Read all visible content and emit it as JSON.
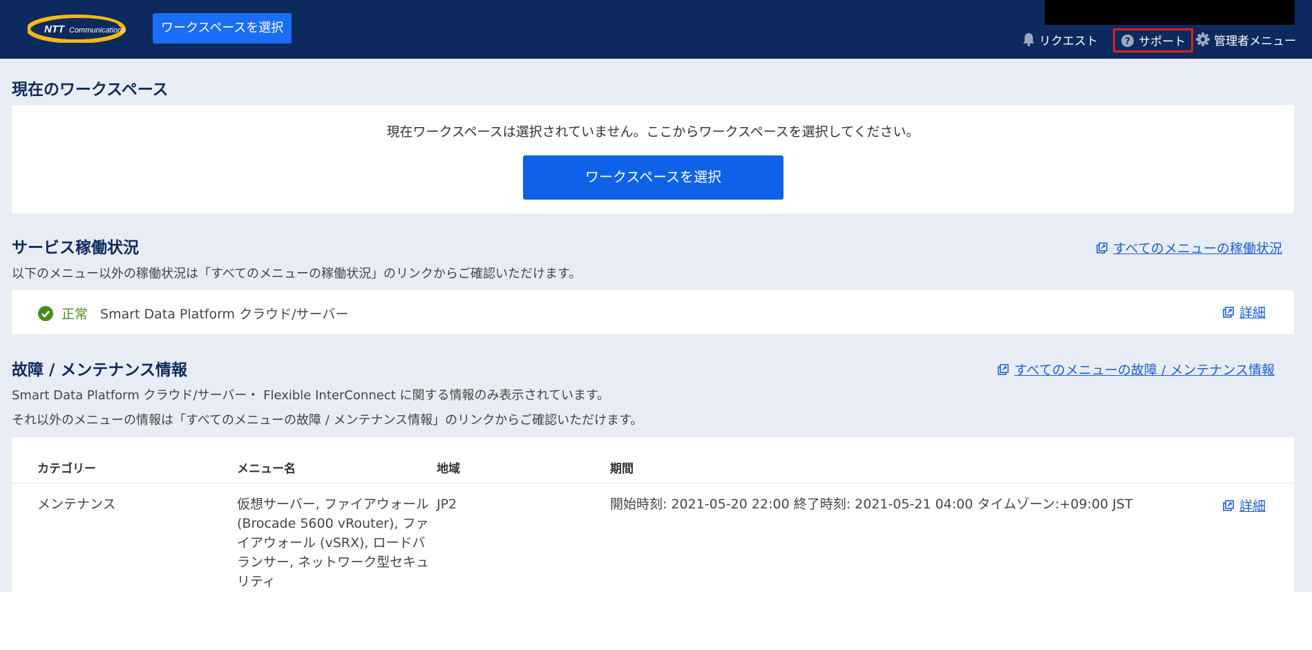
{
  "header": {
    "logo_text": "NTT Communications",
    "select_workspace_label": "ワークスペースを選択",
    "nav": {
      "request_label": "リクエスト",
      "support_label": "サポート",
      "admin_label": "管理者メニュー"
    }
  },
  "current_workspace": {
    "title": "現在のワークスペース",
    "message": "現在ワークスペースは選択されていません。ここからワークスペースを選択してください。",
    "button_label": "ワークスペースを選択"
  },
  "service_status": {
    "title": "サービス稼働状況",
    "description": "以下のメニュー以外の稼働状況は「すべてのメニューの稼働状況」のリンクからご確認いただけます。",
    "all_link": "すべてのメニューの稼働状況",
    "item": {
      "status": "正常",
      "name": "Smart Data Platform クラウド/サーバー",
      "detail_link": "詳細"
    }
  },
  "maintenance": {
    "title": "故障 / メンテナンス情報",
    "all_link": "すべてのメニューの故障 / メンテナンス情報",
    "description1": "Smart Data Platform クラウド/サーバー・ Flexible InterConnect に関する情報のみ表示されています。",
    "description2": "それ以外のメニューの情報は「すべてのメニューの故障 / メンテナンス情報」のリンクからご確認いただけます。",
    "columns": {
      "category": "カテゴリー",
      "menu": "メニュー名",
      "region": "地域",
      "period": "期間"
    },
    "rows": [
      {
        "category": "メンテナンス",
        "menu": "仮想サーバー, ファイアウォール (Brocade 5600 vRouter), ファイアウォール (vSRX), ロードバランサー, ネットワーク型セキュリティ",
        "region": "JP2",
        "period": "開始時刻: 2021-05-20 22:00 終了時刻: 2021-05-21 04:00 タイムゾーン:+09:00 JST",
        "detail_link": "詳細"
      }
    ]
  },
  "colors": {
    "header_bg": "#0d2a5e",
    "accent": "#1a6ef5",
    "link": "#1a5fd6",
    "ok": "#4a8c1c",
    "highlight_border": "#e0201e"
  }
}
